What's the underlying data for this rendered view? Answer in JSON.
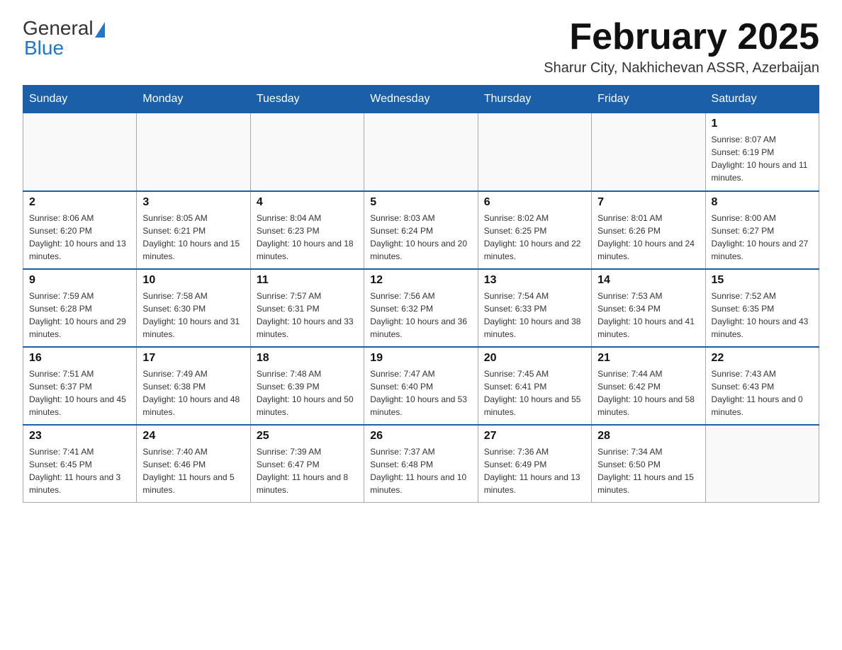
{
  "header": {
    "logo_general": "General",
    "logo_blue": "Blue",
    "month_title": "February 2025",
    "location": "Sharur City, Nakhichevan ASSR, Azerbaijan"
  },
  "weekdays": [
    "Sunday",
    "Monday",
    "Tuesday",
    "Wednesday",
    "Thursday",
    "Friday",
    "Saturday"
  ],
  "weeks": [
    [
      {
        "day": "",
        "info": ""
      },
      {
        "day": "",
        "info": ""
      },
      {
        "day": "",
        "info": ""
      },
      {
        "day": "",
        "info": ""
      },
      {
        "day": "",
        "info": ""
      },
      {
        "day": "",
        "info": ""
      },
      {
        "day": "1",
        "info": "Sunrise: 8:07 AM\nSunset: 6:19 PM\nDaylight: 10 hours and 11 minutes."
      }
    ],
    [
      {
        "day": "2",
        "info": "Sunrise: 8:06 AM\nSunset: 6:20 PM\nDaylight: 10 hours and 13 minutes."
      },
      {
        "day": "3",
        "info": "Sunrise: 8:05 AM\nSunset: 6:21 PM\nDaylight: 10 hours and 15 minutes."
      },
      {
        "day": "4",
        "info": "Sunrise: 8:04 AM\nSunset: 6:23 PM\nDaylight: 10 hours and 18 minutes."
      },
      {
        "day": "5",
        "info": "Sunrise: 8:03 AM\nSunset: 6:24 PM\nDaylight: 10 hours and 20 minutes."
      },
      {
        "day": "6",
        "info": "Sunrise: 8:02 AM\nSunset: 6:25 PM\nDaylight: 10 hours and 22 minutes."
      },
      {
        "day": "7",
        "info": "Sunrise: 8:01 AM\nSunset: 6:26 PM\nDaylight: 10 hours and 24 minutes."
      },
      {
        "day": "8",
        "info": "Sunrise: 8:00 AM\nSunset: 6:27 PM\nDaylight: 10 hours and 27 minutes."
      }
    ],
    [
      {
        "day": "9",
        "info": "Sunrise: 7:59 AM\nSunset: 6:28 PM\nDaylight: 10 hours and 29 minutes."
      },
      {
        "day": "10",
        "info": "Sunrise: 7:58 AM\nSunset: 6:30 PM\nDaylight: 10 hours and 31 minutes."
      },
      {
        "day": "11",
        "info": "Sunrise: 7:57 AM\nSunset: 6:31 PM\nDaylight: 10 hours and 33 minutes."
      },
      {
        "day": "12",
        "info": "Sunrise: 7:56 AM\nSunset: 6:32 PM\nDaylight: 10 hours and 36 minutes."
      },
      {
        "day": "13",
        "info": "Sunrise: 7:54 AM\nSunset: 6:33 PM\nDaylight: 10 hours and 38 minutes."
      },
      {
        "day": "14",
        "info": "Sunrise: 7:53 AM\nSunset: 6:34 PM\nDaylight: 10 hours and 41 minutes."
      },
      {
        "day": "15",
        "info": "Sunrise: 7:52 AM\nSunset: 6:35 PM\nDaylight: 10 hours and 43 minutes."
      }
    ],
    [
      {
        "day": "16",
        "info": "Sunrise: 7:51 AM\nSunset: 6:37 PM\nDaylight: 10 hours and 45 minutes."
      },
      {
        "day": "17",
        "info": "Sunrise: 7:49 AM\nSunset: 6:38 PM\nDaylight: 10 hours and 48 minutes."
      },
      {
        "day": "18",
        "info": "Sunrise: 7:48 AM\nSunset: 6:39 PM\nDaylight: 10 hours and 50 minutes."
      },
      {
        "day": "19",
        "info": "Sunrise: 7:47 AM\nSunset: 6:40 PM\nDaylight: 10 hours and 53 minutes."
      },
      {
        "day": "20",
        "info": "Sunrise: 7:45 AM\nSunset: 6:41 PM\nDaylight: 10 hours and 55 minutes."
      },
      {
        "day": "21",
        "info": "Sunrise: 7:44 AM\nSunset: 6:42 PM\nDaylight: 10 hours and 58 minutes."
      },
      {
        "day": "22",
        "info": "Sunrise: 7:43 AM\nSunset: 6:43 PM\nDaylight: 11 hours and 0 minutes."
      }
    ],
    [
      {
        "day": "23",
        "info": "Sunrise: 7:41 AM\nSunset: 6:45 PM\nDaylight: 11 hours and 3 minutes."
      },
      {
        "day": "24",
        "info": "Sunrise: 7:40 AM\nSunset: 6:46 PM\nDaylight: 11 hours and 5 minutes."
      },
      {
        "day": "25",
        "info": "Sunrise: 7:39 AM\nSunset: 6:47 PM\nDaylight: 11 hours and 8 minutes."
      },
      {
        "day": "26",
        "info": "Sunrise: 7:37 AM\nSunset: 6:48 PM\nDaylight: 11 hours and 10 minutes."
      },
      {
        "day": "27",
        "info": "Sunrise: 7:36 AM\nSunset: 6:49 PM\nDaylight: 11 hours and 13 minutes."
      },
      {
        "day": "28",
        "info": "Sunrise: 7:34 AM\nSunset: 6:50 PM\nDaylight: 11 hours and 15 minutes."
      },
      {
        "day": "",
        "info": ""
      }
    ]
  ]
}
